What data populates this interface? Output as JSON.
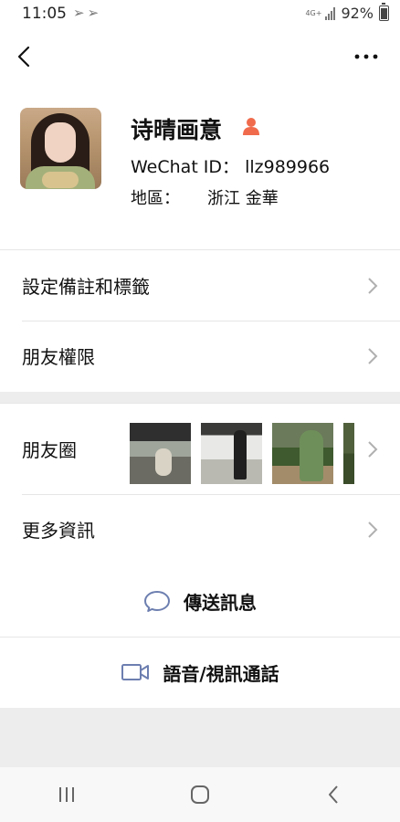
{
  "status_bar": {
    "time": "11:05",
    "arrows": "➢➢",
    "network": "4G+",
    "battery": "92%"
  },
  "profile": {
    "name": "诗晴画意",
    "wechat_id": "WeChat ID： llz989966",
    "region_label": "地區：",
    "region_value": "浙江  金華"
  },
  "rows": {
    "remark_tags": "設定備註和標籤",
    "friend_permissions": "朋友權限",
    "moments": "朋友圈",
    "more_info": "更多資訊"
  },
  "actions": {
    "send_message": "傳送訊息",
    "voice_video_call": "語音/視訊通話"
  },
  "colors": {
    "accent_person_icon": "#f06b4c",
    "action_icon": "#6d7fb0",
    "background_gray": "#ededed"
  },
  "icons": {
    "back": "back-arrow-icon",
    "more": "more-dots-icon",
    "person": "person-icon",
    "chat": "chat-bubble-icon",
    "video": "video-camera-icon"
  }
}
